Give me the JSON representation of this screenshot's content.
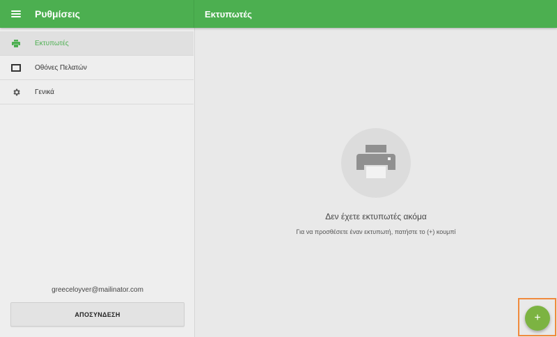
{
  "header": {
    "title": "Ρυθμίσεις",
    "section_title": "Εκτυπωτές"
  },
  "sidebar": {
    "items": [
      {
        "label": "Εκτυπωτές",
        "icon": "printer-icon",
        "active": true
      },
      {
        "label": "Οθόνες Πελατών",
        "icon": "display-icon",
        "active": false
      },
      {
        "label": "Γενικά",
        "icon": "gear-icon",
        "active": false
      }
    ],
    "email": "greeceloyver@mailinator.com",
    "logout_label": "ΑΠΟΣΥΝΔΕΣΗ"
  },
  "main": {
    "empty_icon": "printer-icon",
    "empty_title": "Δεν έχετε εκτυπωτές ακόμα",
    "empty_subtitle": "Για να προσθέσετε έναν εκτυπωτή, πατήστε το (+) κουμπί"
  },
  "fab": {
    "label": "+",
    "icon": "plus-icon"
  },
  "colors": {
    "primary": "#4caf50",
    "fab": "#7cb342",
    "highlight": "#f08a3c"
  }
}
